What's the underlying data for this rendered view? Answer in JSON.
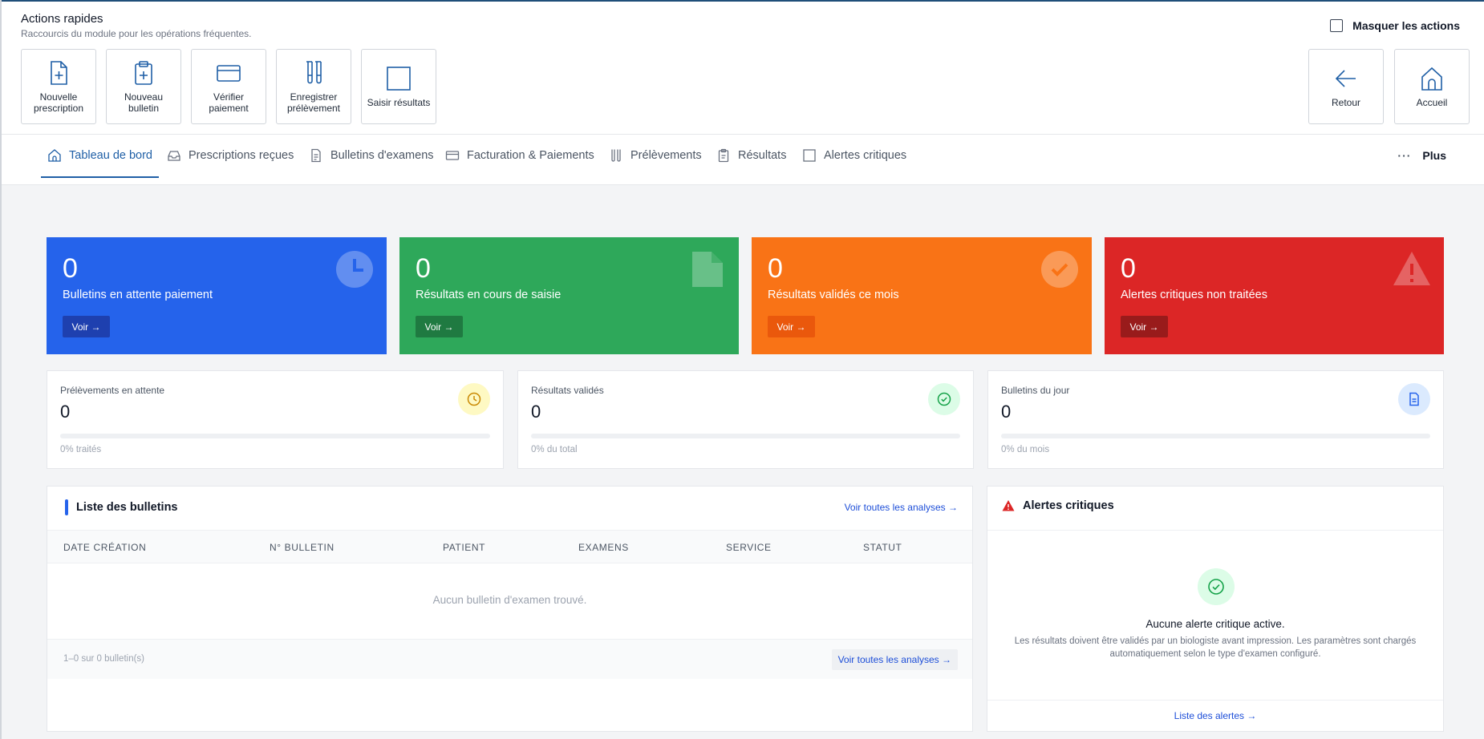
{
  "quick_actions": {
    "title": "Actions rapides",
    "subtitle": "Raccourcis du module pour les opérations fréquentes.",
    "hide_label": "Masquer les actions",
    "buttons": [
      {
        "label": "Nouvelle prescription",
        "icon": "file-plus-icon"
      },
      {
        "label": "Nouveau bulletin",
        "icon": "clipboard-plus-icon"
      },
      {
        "label": "Vérifier paiement",
        "icon": "credit-card-icon"
      },
      {
        "label": "Enregistrer prélèvement",
        "icon": "test-tubes-icon"
      },
      {
        "label": "Saisir résultats",
        "icon": "square-icon"
      }
    ],
    "nav_buttons": [
      {
        "label": "Retour",
        "icon": "arrow-left-icon"
      },
      {
        "label": "Accueil",
        "icon": "home-icon"
      }
    ]
  },
  "tabs": [
    {
      "label": "Tableau de bord",
      "icon": "home-icon",
      "active": true
    },
    {
      "label": "Prescriptions reçues",
      "icon": "inbox-icon"
    },
    {
      "label": "Bulletins d'examens",
      "icon": "document-icon"
    },
    {
      "label": "Facturation & Paiements",
      "icon": "credit-card-icon"
    },
    {
      "label": "Prélèvements",
      "icon": "test-tubes-icon"
    },
    {
      "label": "Résultats",
      "icon": "clipboard-icon"
    },
    {
      "label": "Alertes critiques",
      "icon": "square-icon"
    }
  ],
  "tabs_more": {
    "dots": "···",
    "label": "Plus"
  },
  "stat_cards": [
    {
      "value": "0",
      "label": "Bulletins en attente paiement",
      "button": "Voir →",
      "color": "#2563eb",
      "btn_color": "#1e40af",
      "icon": "clock-icon"
    },
    {
      "value": "0",
      "label": "Résultats en cours de saisie",
      "button": "Voir →",
      "color": "#2ea85a",
      "btn_color": "#1f7a41",
      "icon": "file-icon"
    },
    {
      "value": "0",
      "label": "Résultats validés ce mois",
      "button": "Voir →",
      "color": "#f97316",
      "btn_color": "#ea580c",
      "icon": "check-circle-icon"
    },
    {
      "value": "0",
      "label": "Alertes critiques non traitées",
      "button": "Voir →",
      "color": "#dc2626",
      "btn_color": "#991b1b",
      "icon": "warning-icon"
    }
  ],
  "mini_cards": [
    {
      "label": "Prélèvements en attente",
      "value": "0",
      "progress": 0,
      "sub": "0% traités",
      "icon": "clock-icon",
      "icon_bg": "#fef9c3",
      "icon_color": "#ca8a04"
    },
    {
      "label": "Résultats validés",
      "value": "0",
      "progress": 0,
      "sub": "0% du total",
      "icon": "check-circle-icon",
      "icon_bg": "#dcfce7",
      "icon_color": "#16a34a"
    },
    {
      "label": "Bulletins du jour",
      "value": "0",
      "progress": 0,
      "sub": "0% du mois",
      "icon": "document-icon",
      "icon_bg": "#dbeafe",
      "icon_color": "#2563eb"
    }
  ],
  "bulletins": {
    "title": "Liste des bulletins",
    "link_top": "Voir toutes les analyses →",
    "columns": [
      "DATE CRÉATION",
      "N° BULLETIN",
      "PATIENT",
      "EXAMENS",
      "SERVICE",
      "STATUT"
    ],
    "empty": "Aucun bulletin d'examen trouvé.",
    "count": "1–0 sur 0 bulletin(s)",
    "link_bottom": "Voir toutes les analyses →"
  },
  "alerts": {
    "title": "Alertes critiques",
    "ok_title": "Aucune alerte critique active.",
    "ok_desc": "Les résultats doivent être validés par un biologiste avant impression. Les paramètres sont chargés automatiquement selon le type d'examen configuré.",
    "link": "Liste des alertes →"
  }
}
